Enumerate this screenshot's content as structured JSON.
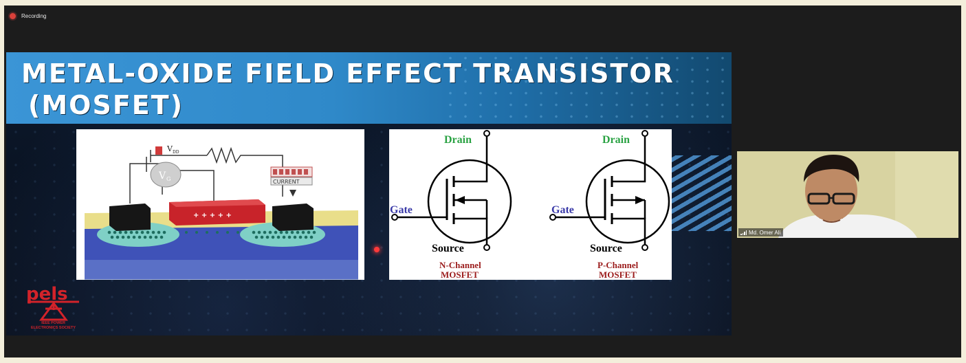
{
  "recording": {
    "label": "Recording",
    "color": "#d9413a"
  },
  "slide": {
    "title_line1": "METAL-OXIDE FIELD EFFECT TRANSISTOR",
    "title_line2": "(MOSFET)",
    "left_figure": {
      "vdd_label": "V",
      "vdd_subscript": "DD",
      "vg_label": "V",
      "vg_subscript": "G",
      "current_label": "CURRENT",
      "charges": "+ + + + +"
    },
    "right_figure": {
      "n_channel": {
        "drain": "Drain",
        "gate": "Gate",
        "source": "Source",
        "caption_line1": "N-Channel",
        "caption_line2": "MOSFET"
      },
      "p_channel": {
        "drain": "Drain",
        "gate": "Gate",
        "source": "Source",
        "caption_line1": "P-Channel",
        "caption_line2": "MOSFET"
      }
    },
    "logo": {
      "wordmark": "pels",
      "subtitle_line1": "IEEE POWER",
      "subtitle_line2": "ELECTRONICS SOCIETY",
      "color": "#d2232a"
    }
  },
  "video_tile": {
    "participant_name": "Md. Omer Ali",
    "icon": "signal-bars-icon"
  },
  "colors": {
    "drain_label": "#2aa243",
    "gate_label": "#3a3aa8",
    "caption": "#9b1c1c"
  }
}
